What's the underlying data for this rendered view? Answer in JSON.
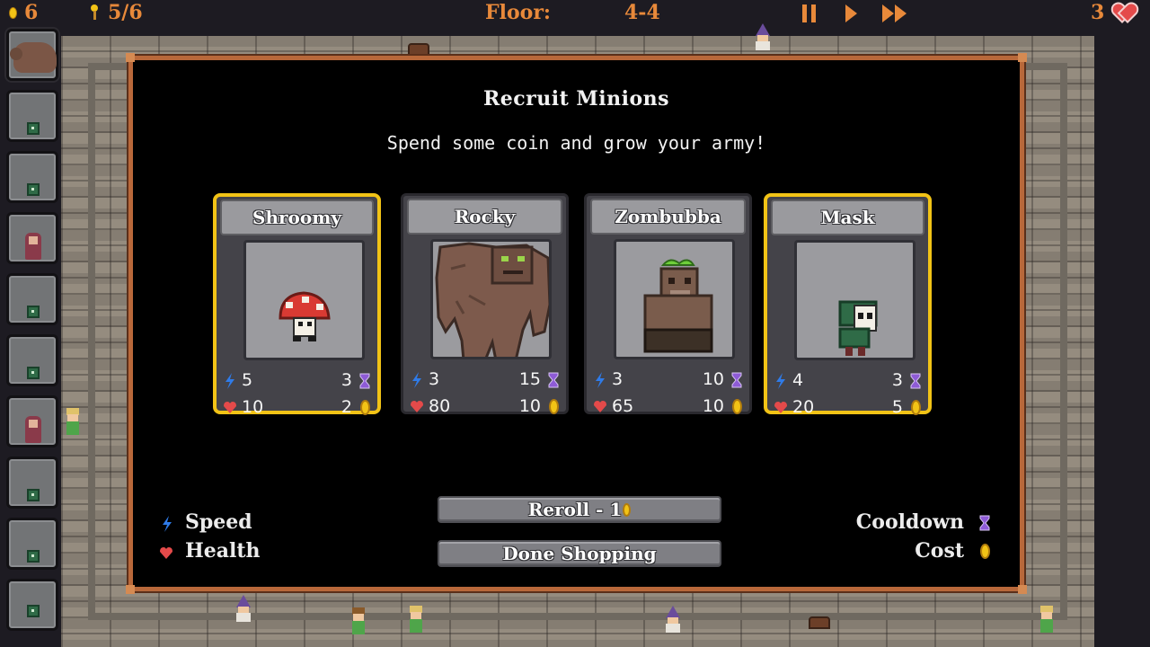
{
  "topbar": {
    "gold": "6",
    "minions_count": "5/6",
    "floor_label": "Floor:",
    "floor_value": "4-4",
    "lives": "3",
    "icons": [
      "coin-icon",
      "torch-icon",
      "pause-icon",
      "play-icon",
      "fast-forward-icon",
      "heart-icon"
    ]
  },
  "modal": {
    "title": "Recruit Minions",
    "subtitle": "Spend some coin and grow your army!"
  },
  "cards": [
    {
      "name": "Shroomy",
      "speed": "5",
      "cooldown": "3",
      "health": "10",
      "cost": "2",
      "selected": true
    },
    {
      "name": "Rocky",
      "speed": "3",
      "cooldown": "15",
      "health": "80",
      "cost": "10",
      "selected": false
    },
    {
      "name": "Zombubba",
      "speed": "3",
      "cooldown": "10",
      "health": "65",
      "cost": "10",
      "selected": false
    },
    {
      "name": "Mask",
      "speed": "4",
      "cooldown": "3",
      "health": "20",
      "cost": "5",
      "selected": true
    }
  ],
  "buttons": {
    "reroll": "Reroll - 1",
    "done": "Done Shopping"
  },
  "legend": {
    "speed": "Speed",
    "health": "Health",
    "cooldown": "Cooldown",
    "cost": "Cost"
  },
  "colors": {
    "accent": "#e8893a",
    "gold": "#f2c316",
    "speed": "#2f7be8",
    "health": "#e44a4a",
    "cooldown": "#8e5bd6",
    "frame": "#b8683a"
  }
}
